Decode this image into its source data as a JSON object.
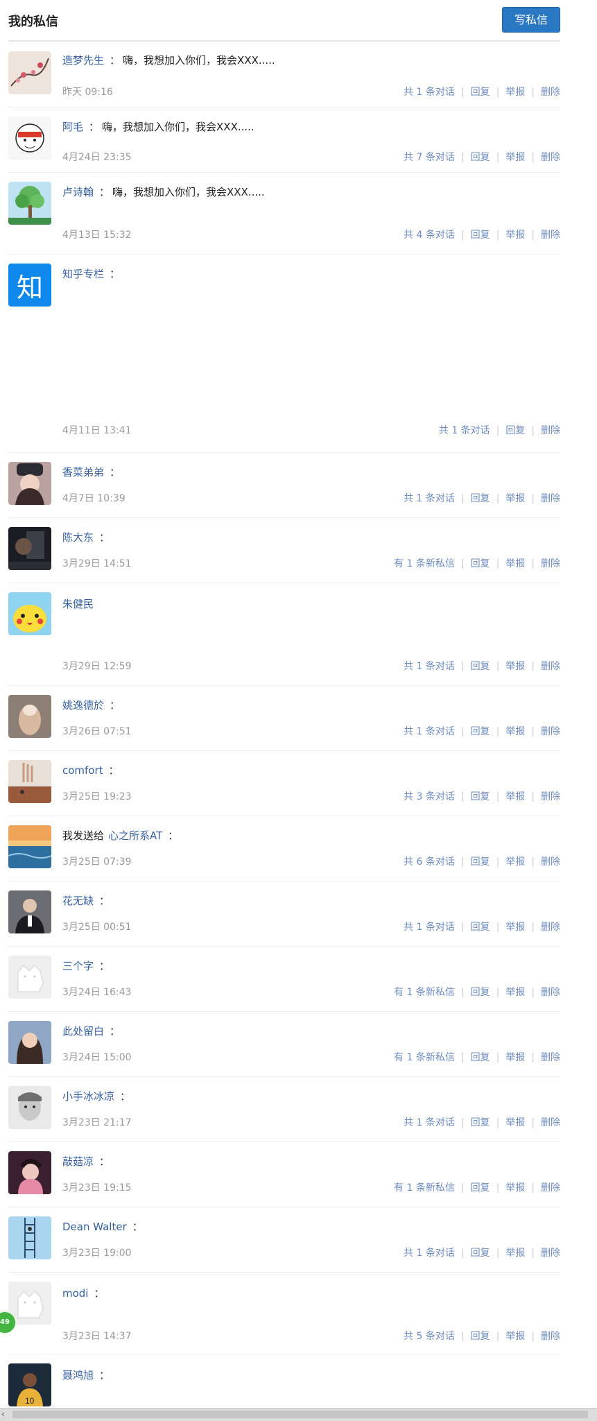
{
  "header": {
    "title": "我的私信",
    "write_button": "写私信"
  },
  "actions": {
    "reply": "回复",
    "report": "举报",
    "delete": "删除"
  },
  "messages": [
    {
      "name": "造梦先生",
      "preview": "嗨，我想加入你们，我会XXX.....",
      "time": "昨天 09:16",
      "summary": "共 1 条对话",
      "avatar_icon": "plum-blossom-avatar"
    },
    {
      "name": "阿毛",
      "preview": "嗨，我想加入你们，我会XXX.....",
      "time": "4月24日 23:35",
      "summary": "共 7 条对话",
      "avatar_icon": "sketch-avatar"
    },
    {
      "name": "卢诗翰",
      "preview": "嗨，我想加入你们，我会XXX.....",
      "time": "4月13日 15:32",
      "summary": "共 4 条对话",
      "avatar_icon": "tree-avatar"
    },
    {
      "name": "知乎专栏",
      "preview": "",
      "time": "4月11日 13:41",
      "summary": "共 1 条对话",
      "avatar_icon": "zhihu-logo",
      "avatar_text": "知"
    },
    {
      "name": "香菜弟弟",
      "preview": "",
      "time": "4月7日 10:39",
      "summary": "共 1 条对话",
      "avatar_icon": "girl-hat-avatar"
    },
    {
      "name": "陈大东",
      "preview": "",
      "time": "3月29日 14:51",
      "summary": "有 1 条新私信",
      "avatar_icon": "dark-photo-avatar"
    },
    {
      "name": "朱健民",
      "preview": "",
      "time": "3月29日 12:59",
      "summary": "共 1 条对话",
      "avatar_icon": "pikachu-avatar"
    },
    {
      "name": "姚逸德於",
      "preview": "",
      "time": "3月26日 07:51",
      "summary": "共 1 条对话",
      "avatar_icon": "thumb-avatar"
    },
    {
      "name": "comfort",
      "preview": "",
      "time": "3月25日 19:23",
      "summary": "共 3 条对话",
      "avatar_icon": "desert-hand-avatar"
    },
    {
      "name": "心之所系AT",
      "prefix": "我发送给",
      "preview": "",
      "time": "3月25日 07:39",
      "summary": "共 6 条对话",
      "avatar_icon": "seascape-avatar"
    },
    {
      "name": "花无缺",
      "preview": "",
      "time": "3月25日 00:51",
      "summary": "共 1 条对话",
      "avatar_icon": "speaker-avatar"
    },
    {
      "name": "三个字",
      "preview": "",
      "time": "3月24日 16:43",
      "summary": "有 1 条新私信",
      "avatar_icon": "default-avatar"
    },
    {
      "name": "此处留白",
      "preview": "",
      "time": "3月24日 15:00",
      "summary": "有 1 条新私信",
      "avatar_icon": "woman-avatar"
    },
    {
      "name": "小手冰冰凉",
      "preview": "",
      "time": "3月23日 21:17",
      "summary": "共 1 条对话",
      "avatar_icon": "bw-portrait-avatar"
    },
    {
      "name": "敲菇凉",
      "preview": "",
      "time": "3月23日 19:15",
      "summary": "有 1 条新私信",
      "avatar_icon": "pink-girl-avatar"
    },
    {
      "name": "Dean Walter",
      "preview": "",
      "time": "3月23日 19:00",
      "summary": "共 1 条对话",
      "avatar_icon": "ladder-avatar"
    },
    {
      "name": "modi",
      "preview": "",
      "time": "3月23日 14:37",
      "summary": "共 5 条对话",
      "avatar_icon": "default-avatar"
    },
    {
      "name": "聂鸿旭",
      "preview": "",
      "time": "",
      "summary": "",
      "avatar_icon": "basketball-avatar"
    }
  ],
  "floating_badge": "49"
}
